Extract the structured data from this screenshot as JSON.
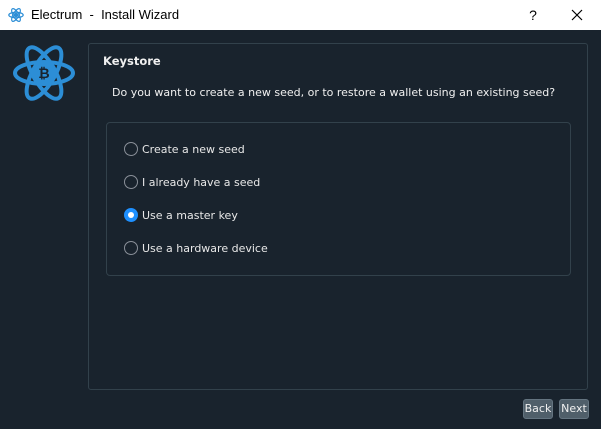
{
  "window": {
    "title": "Electrum  -  Install Wizard",
    "help_label": "?"
  },
  "panel": {
    "title": "Keystore",
    "question": "Do you want to create a new seed, or to restore a wallet using an existing seed?"
  },
  "options": [
    {
      "label": "Create a new seed",
      "checked": false
    },
    {
      "label": "I already have a seed",
      "checked": false
    },
    {
      "label": "Use a master key",
      "checked": true
    },
    {
      "label": "Use a hardware device",
      "checked": false
    }
  ],
  "buttons": {
    "back": "Back",
    "next": "Next"
  },
  "colors": {
    "background": "#19232d",
    "accent": "#1e90ff",
    "logo": "#2c8ed6"
  },
  "icons": {
    "app": "electrum-logo-icon",
    "close": "close-icon",
    "help": "help-icon"
  }
}
